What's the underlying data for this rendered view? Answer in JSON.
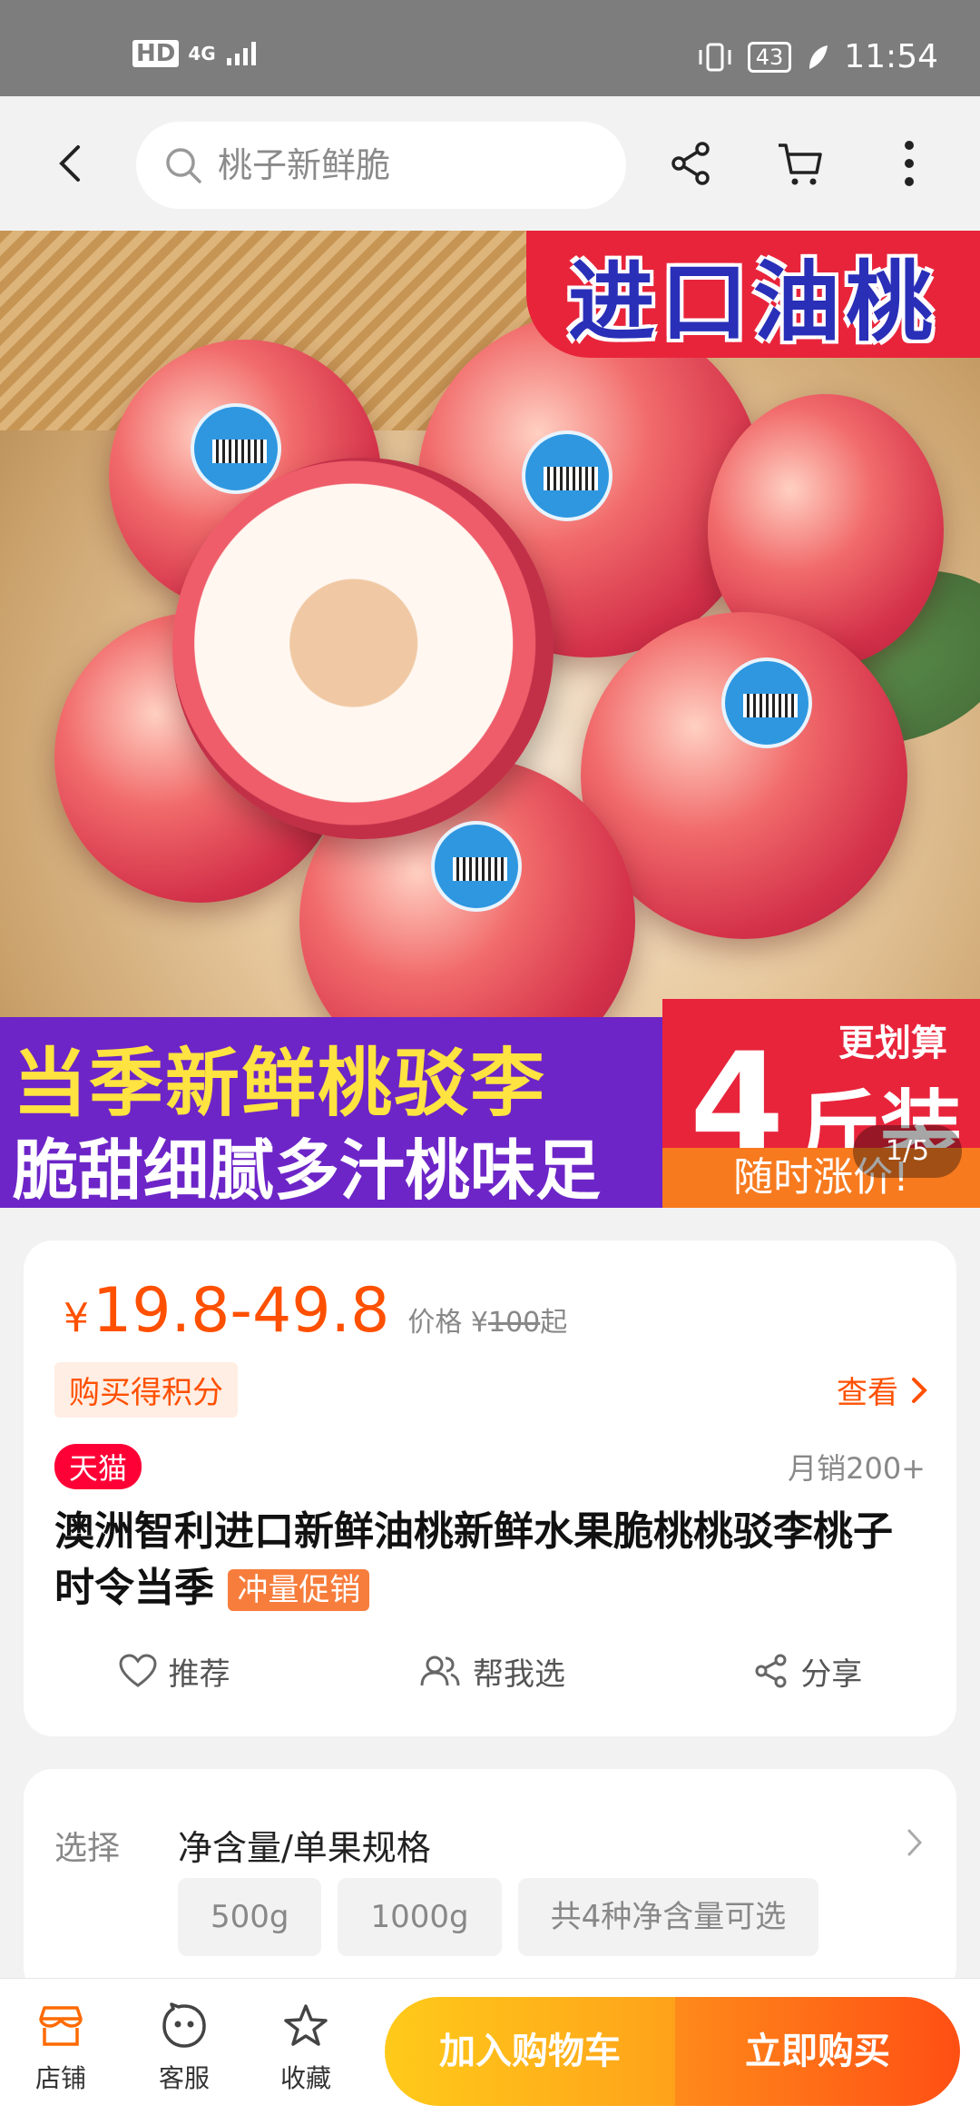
{
  "status_bar": {
    "network_left": "HD",
    "signal": "4G",
    "battery": "43",
    "time": "11:54"
  },
  "search": {
    "placeholder": "桃子新鲜脆"
  },
  "hero": {
    "banner_top": "进口油桃",
    "banner_bottom_line1": "当季新鲜桃驳李",
    "banner_bottom_line2": "脆甜细腻多汁桃味足",
    "banner_right_top": "更划算",
    "banner_right_big": "4",
    "banner_right_unit": "斤装",
    "banner_right_bottom": "随时涨价!",
    "pager": "1/5"
  },
  "product": {
    "currency": "¥",
    "price_range": "19.8-49.8",
    "orig_prefix": "价格 ¥",
    "orig_price": "100",
    "orig_suffix": "起",
    "points_badge": "购买得积分",
    "view_more": "查看",
    "store_badge": "天猫",
    "monthly_sales": "月销200+",
    "title": "澳洲智利进口新鲜油桃新鲜水果脆桃桃驳李桃子时令当季",
    "promo_tag": "冲量促销",
    "actions": [
      {
        "label": "推荐",
        "icon": "heart-icon"
      },
      {
        "label": "帮我选",
        "icon": "users-icon"
      },
      {
        "label": "分享",
        "icon": "share-icon"
      }
    ]
  },
  "selection": {
    "label": "选择",
    "title": "净含量/单果规格",
    "options": [
      "500g",
      "1000g",
      "共4种净含量可选"
    ]
  },
  "bottom_bar": {
    "store": "店铺",
    "service": "客服",
    "favorite": "收藏",
    "add_to_cart": "加入购物车",
    "buy_now": "立即购买"
  },
  "colors": {
    "accent": "#ff5000",
    "cart_button": "#ffb21a",
    "buy_button": "#ff5a14",
    "tmall": "#ff0036"
  }
}
